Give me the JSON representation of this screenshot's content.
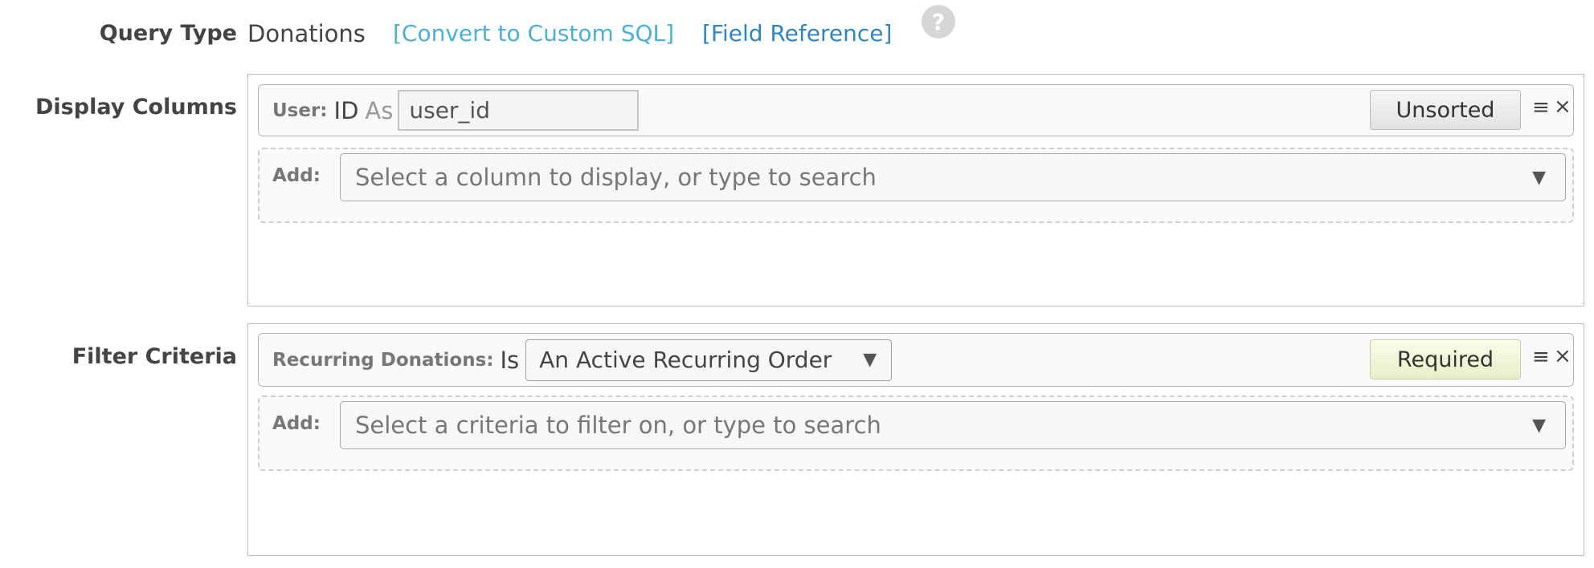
{
  "query_type": {
    "label": "Query Type",
    "value": "Donations",
    "convert_link": "[Convert to Custom SQL]",
    "reference_link": "[Field Reference]",
    "help_glyph": "?"
  },
  "display_columns": {
    "label": "Display Columns",
    "rows": [
      {
        "field_label": "User:",
        "field_name": "ID",
        "as_word": "As",
        "alias_value": "user_id",
        "sort_button": "Unsorted"
      }
    ],
    "add_label": "Add:",
    "add_placeholder": "Select a column to display, or type to search"
  },
  "filter_criteria": {
    "label": "Filter Criteria",
    "rows": [
      {
        "field_label": "Recurring Donations:",
        "operator": "Is",
        "selected_value": "An Active Recurring Order",
        "required_button": "Required"
      }
    ],
    "add_label": "Add:",
    "add_placeholder": "Select a criteria to filter on, or type to search"
  },
  "icons": {
    "menu_glyph": "≡",
    "close_glyph": "×",
    "dropdown_glyph": "▼"
  },
  "colors": {
    "link_primary": "#4db0d6",
    "link_secondary": "#2f86c0",
    "required_bg": "#eef4d8"
  }
}
